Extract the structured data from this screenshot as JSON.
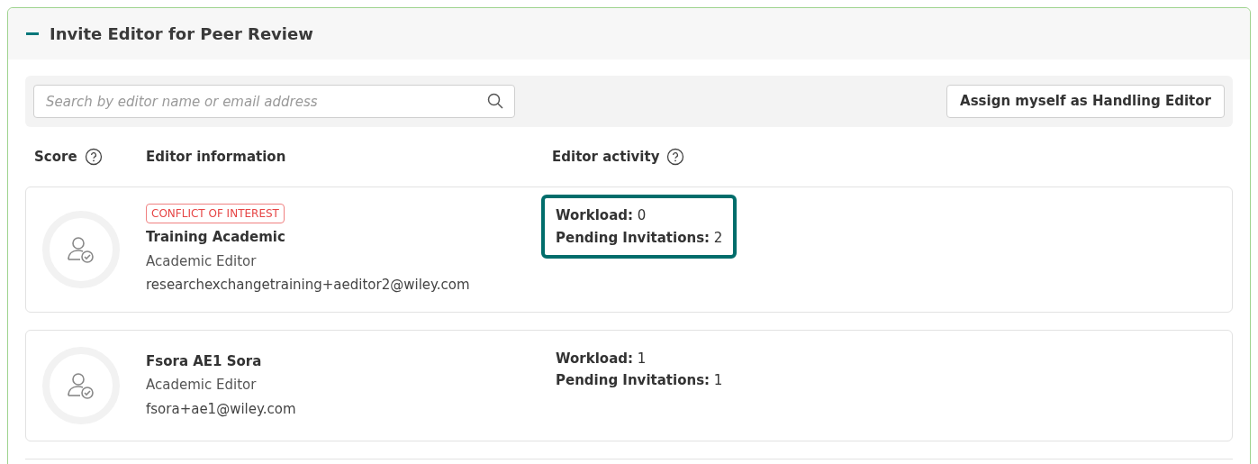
{
  "section": {
    "title": "Invite Editor for Peer Review",
    "expanded": true
  },
  "search": {
    "placeholder": "Search by editor name or email address"
  },
  "assign_button": "Assign myself as Handling Editor",
  "columns": [
    {
      "label": "Score",
      "help": true
    },
    {
      "label": "Editor information",
      "help": false
    },
    {
      "label": "Editor activity",
      "help": true
    }
  ],
  "editors": [
    {
      "badge": "CONFLICT OF INTEREST",
      "name": "Training Academic",
      "role": "Academic Editor",
      "email": "researchexchangetraining+aeditor2@wiley.com",
      "workload_label": "Workload:",
      "workload": "0",
      "pending_label": "Pending Invitations:",
      "pending": "2",
      "highlighted": true
    },
    {
      "name": "Fsora AE1 Sora",
      "role": "Academic Editor",
      "email": "fsora+ae1@wiley.com",
      "workload_label": "Workload:",
      "workload": "1",
      "pending_label": "Pending Invitations:",
      "pending": "1",
      "highlighted": false
    }
  ]
}
